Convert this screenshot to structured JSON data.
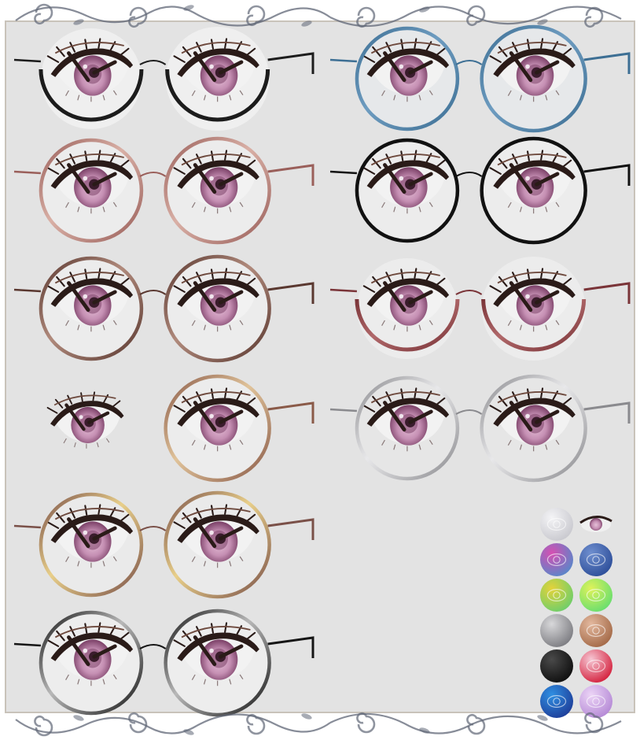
{
  "sheet": {
    "background": "#e3e3e3",
    "frame_color": "#c9c3ba",
    "flourish_color": "#5f6676"
  },
  "eye": {
    "iris": "#c58fb3",
    "iris_dark": "#7a3f66",
    "pupil": "#3a1c2c",
    "lash": "#2a1b18",
    "lid": "#6e4a3e",
    "white": "#f2f2f2"
  },
  "glasses": [
    {
      "name": "black-bottom-rim",
      "style": "lower",
      "frame": "#1c1c1c",
      "accent": "#1c1c1c",
      "lens": "#efefef",
      "inner_eye": true
    },
    {
      "name": "blue-round",
      "style": "round",
      "frame": "#3d6f94",
      "accent": "#6e9cc0",
      "lens": "#e6e8ea",
      "inner_eye": true
    },
    {
      "name": "rose-gold-round",
      "style": "round",
      "frame": "#9a5f5a",
      "accent": "#d9b0a6",
      "lens": "#ececec",
      "inner_eye": true
    },
    {
      "name": "thin-black-round",
      "style": "round",
      "frame": "#111111",
      "accent": "#111111",
      "lens": "#ececec",
      "inner_eye": true
    },
    {
      "name": "brown-round",
      "style": "round",
      "frame": "#5a3830",
      "accent": "#b08a7c",
      "lens": "#ececec",
      "inner_eye": true
    },
    {
      "name": "maroon-bottom-rim",
      "style": "lower",
      "frame": "#7a3438",
      "accent": "#b0686a",
      "lens": "#ececec",
      "inner_eye": true
    },
    {
      "name": "single-lens-gold",
      "style": "single",
      "frame": "#8a5a48",
      "accent": "#e0c39a",
      "lens": "#ececec",
      "inner_eye": true
    },
    {
      "name": "silver-round",
      "style": "round",
      "frame": "#8a8a8e",
      "accent": "#e8e8ea",
      "lens": "#e6e6e6",
      "inner_eye": true
    },
    {
      "name": "gold-rosewood-round",
      "style": "round",
      "frame": "#7a5048",
      "accent": "#e8cf8a",
      "lens": "#eaeaea",
      "inner_eye": true
    },
    {
      "name": "black-silver-round",
      "style": "round",
      "frame": "#151515",
      "accent": "#b8b8b8",
      "lens": "#ededed",
      "inner_eye": true
    }
  ],
  "palette": {
    "swatches": [
      {
        "name": "swatch-clear",
        "colors": [
          "#f4f4f6",
          "#c9c9cf"
        ],
        "eye": true
      },
      {
        "name": "swatch-eye-preview",
        "colors": [
          "#d8d8d8",
          "#b79ab0"
        ],
        "eye": true,
        "small": true
      },
      {
        "name": "swatch-magenta",
        "colors": [
          "#d64fb2",
          "#5a86c9"
        ],
        "eye": true
      },
      {
        "name": "swatch-blue",
        "colors": [
          "#6f8fcf",
          "#2e4f9a"
        ],
        "eye": true
      },
      {
        "name": "swatch-rainbow",
        "colors": [
          "#e4d23a",
          "#6fce6a"
        ],
        "eye": true
      },
      {
        "name": "swatch-lime",
        "colors": [
          "#dff25a",
          "#69de6e"
        ],
        "eye": true
      },
      {
        "name": "swatch-silver",
        "colors": [
          "#d8d8da",
          "#7d7d82"
        ],
        "eye": false
      },
      {
        "name": "swatch-copper",
        "colors": [
          "#e3b89e",
          "#a46a48"
        ],
        "eye": true
      },
      {
        "name": "swatch-black",
        "colors": [
          "#4a4a4a",
          "#0f0f0f"
        ],
        "eye": false
      },
      {
        "name": "swatch-red",
        "colors": [
          "#f6c7d4",
          "#d4223e"
        ],
        "eye": true
      },
      {
        "name": "swatch-azure",
        "colors": [
          "#2f8fe2",
          "#1f3f9a"
        ],
        "eye": true
      },
      {
        "name": "swatch-lavender",
        "colors": [
          "#ecd4f6",
          "#b58ad6"
        ],
        "eye": true
      }
    ]
  }
}
